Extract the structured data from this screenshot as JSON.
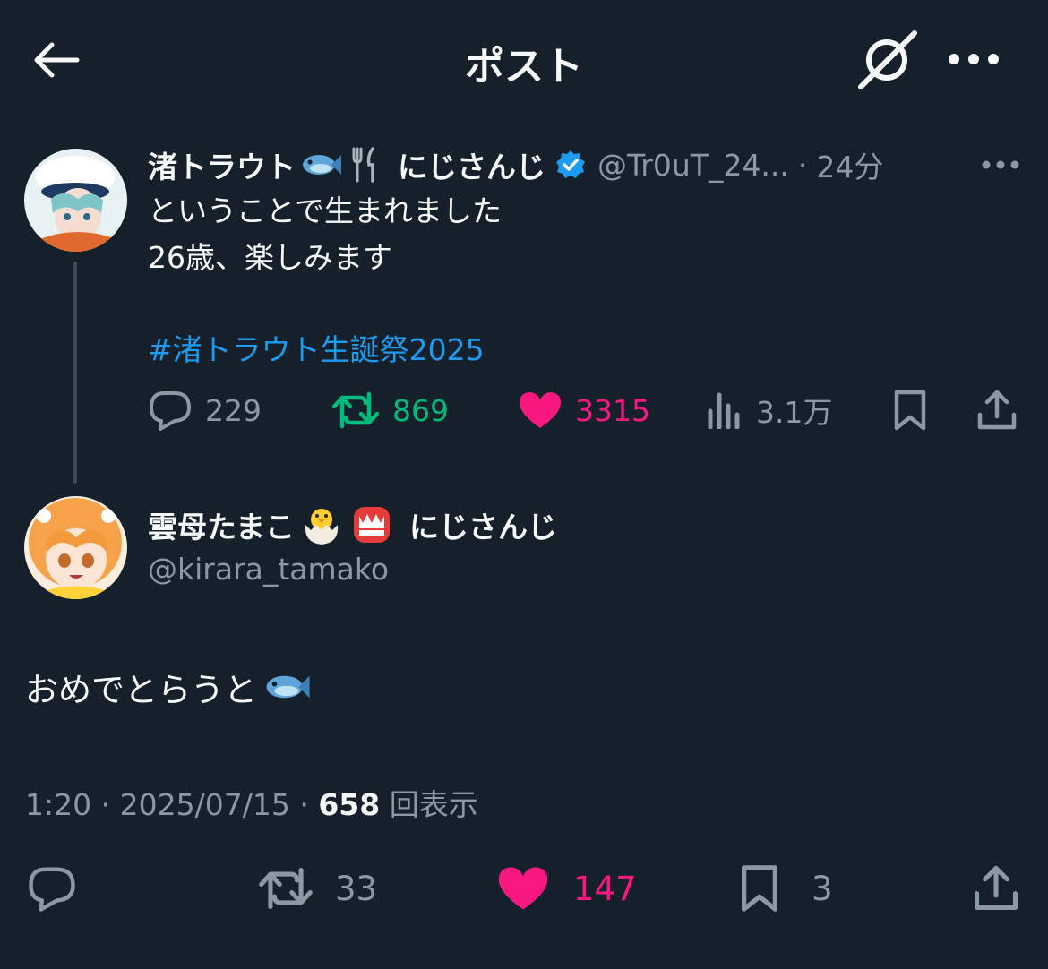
{
  "header": {
    "title": "ポスト",
    "back_icon": "arrow-left-icon",
    "grok_icon": "grok-icon",
    "more_icon": "more-horizontal-icon"
  },
  "parent_post": {
    "display_name": "渚トラウト",
    "affiliation": "にじさんじ",
    "handle": "@Tr0uT_24...",
    "separator": "·",
    "time_ago": "24分",
    "verified_icon": "verified-badge-icon",
    "body_lines": [
      "ということで生まれました",
      "26歳、楽しみます"
    ],
    "hashtag": "#渚トラウト生誕祭2025",
    "stats": {
      "replies": "229",
      "retweets": "869",
      "likes": "3315",
      "views": "3.1万"
    }
  },
  "main_post": {
    "display_name": "雲母たまこ",
    "affiliation": "にじさんじ",
    "handle": "@kirara_tamako",
    "body": "おめでとらうと",
    "time": "1:20",
    "date": "2025/07/15",
    "views_count": "658",
    "views_label": "回表示",
    "meta_separator": "·",
    "stats": {
      "retweets": "33",
      "likes": "147",
      "bookmarks": "3"
    }
  },
  "colors": {
    "background": "#15202b",
    "text": "#f7f9f9",
    "muted": "#8b98a5",
    "link": "#1d9bf0",
    "retweet_green": "#00ba7c",
    "like_pink": "#f91880",
    "thread_line": "#3e4a55"
  }
}
